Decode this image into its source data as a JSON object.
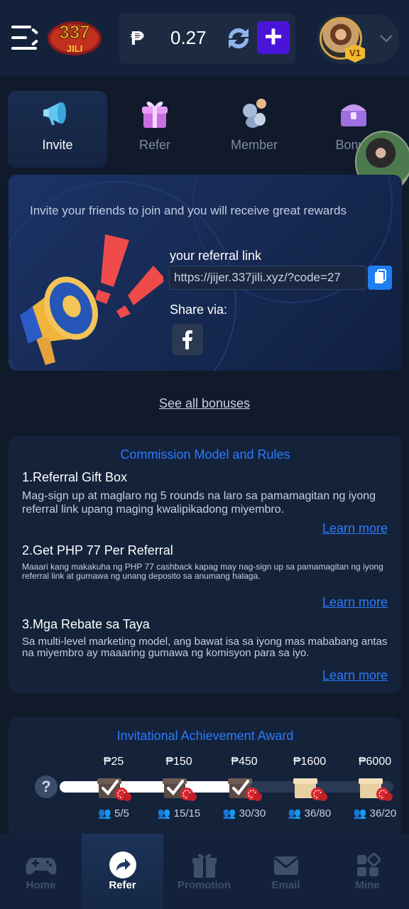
{
  "header": {
    "logo_text_top": "337",
    "logo_text_bottom": "JILI",
    "currency_symbol": "₱",
    "balance": "0.27",
    "add_label": "+",
    "vip_level": "V1"
  },
  "tabs": [
    {
      "label": "Invite",
      "icon": "megaphone-icon",
      "active": true
    },
    {
      "label": "Refer",
      "icon": "gift-box-icon",
      "active": false
    },
    {
      "label": "Member",
      "icon": "members-icon",
      "active": false
    },
    {
      "label": "Bonus",
      "icon": "treasure-chest-icon",
      "active": false
    }
  ],
  "invite": {
    "headline": "Invite your friends to join and you will receive great rewards",
    "referral_label": "your referral link",
    "referral_link": "https://jijer.337jili.xyz/?code=27",
    "share_label": "Share via:"
  },
  "see_all_bonuses": "See all bonuses",
  "commission": {
    "title": "Commission Model and Rules",
    "rules": [
      {
        "title": "1.Referral Gift Box",
        "description": "Mag-sign up at maglaro ng 5 rounds na laro sa pamamagitan ng iyong referral link upang maging kwalipikadong miyembro.",
        "link": "Learn more"
      },
      {
        "title": "2.Get PHP 77 Per Referral",
        "description": "Maaari kang makakuha ng PHP 77 cashback kapag may nag-sign up sa pamamagitan ng iyong referral link at gumawa ng unang deposito sa anumang halaga.",
        "link": "Learn more"
      },
      {
        "title": "3.Mga Rebate sa Taya",
        "description": "Sa multi-level marketing model, ang bawat isa sa iyong mas mababang antas na miyembro ay maaaring gumawa ng komisyon para sa iyo.",
        "link": "Learn more"
      }
    ]
  },
  "achievement": {
    "title": "Invitational Achievement Award",
    "help": "?",
    "progress_fraction": 0.55,
    "milestones": [
      {
        "amount": "₱25",
        "count": "5/5",
        "completed": true
      },
      {
        "amount": "₱150",
        "count": "15/15",
        "completed": true
      },
      {
        "amount": "₱450",
        "count": "30/30",
        "completed": true
      },
      {
        "amount": "₱1600",
        "count": "36/80",
        "completed": false
      },
      {
        "amount": "₱6000",
        "count": "36/20",
        "completed": false
      }
    ]
  },
  "bottom_nav": [
    {
      "label": "Home",
      "icon": "gamepad-icon",
      "active": false
    },
    {
      "label": "Refer",
      "icon": "share-arrow-icon",
      "active": true
    },
    {
      "label": "Promotion",
      "icon": "gift-icon",
      "active": false
    },
    {
      "label": "Email",
      "icon": "envelope-icon",
      "active": false
    },
    {
      "label": "Mine",
      "icon": "grid-icon",
      "active": false
    }
  ],
  "colors": {
    "background": "#101a2b",
    "accent_blue": "#2b7bff",
    "add_button": "#4a14d8",
    "copy_button": "#1f7ef0"
  }
}
